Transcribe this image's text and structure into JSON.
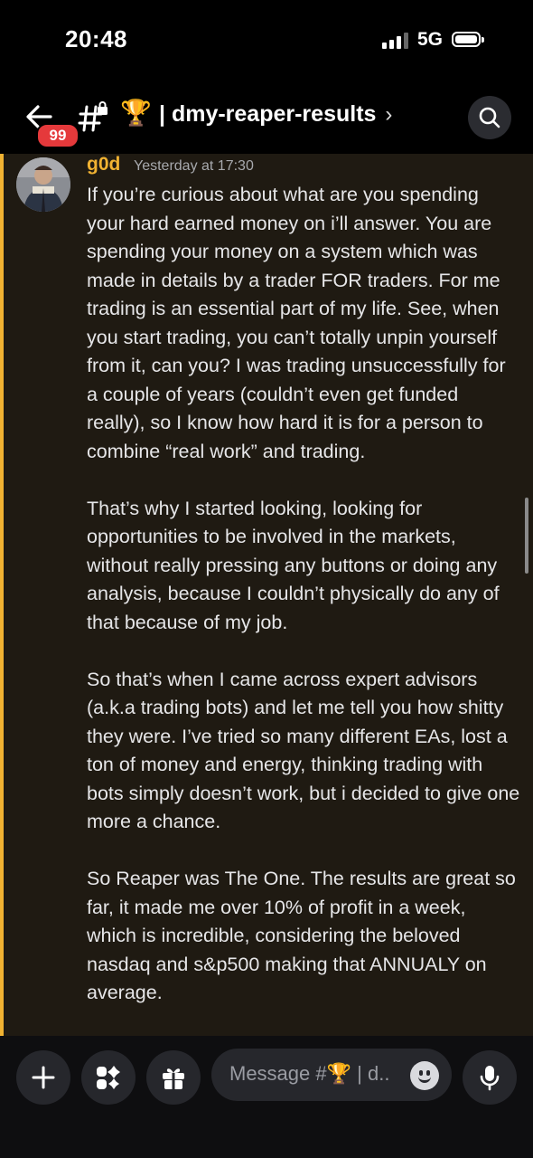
{
  "status_bar": {
    "time": "20:48",
    "network": "5G",
    "signal_bars": 3,
    "signal_max": 4,
    "battery_icon": "battery-icon"
  },
  "header": {
    "back_icon": "back-arrow-icon",
    "unread_badge": "99",
    "channel_icons": "hash-lock-icon",
    "channel_emoji": "🏆",
    "channel_name": "| dmy-reaper-results",
    "chevron": "›",
    "search_icon": "search-icon"
  },
  "message": {
    "author": "g0d",
    "author_color": "#f0b232",
    "timestamp": "Yesterday at 17:30",
    "paragraphs": [
      "If you’re curious about what are you spending your hard earned money on i’ll answer. You are spending your money on a system which was made in details by a trader FOR traders. For me trading is an essential part of my life. See, when you start trading, you can’t totally unpin yourself from it, can you? I was trading unsuccessfully for a couple of years (couldn’t even get funded really), so I know how hard it is for a person to combine “real work” and trading.",
      "That’s why I started looking, looking for opportunities to be involved in the markets, without really pressing any buttons or doing any analysis, because I couldn’t physically do any of that because of my job.",
      "So that’s when I came across expert advisors (a.k.a trading bots) and let me tell you how shitty they were. I’ve tried so many different EAs, lost a ton of money and energy, thinking trading with bots simply doesn’t work, but i decided to give one more a chance.",
      "So Reaper was The One. The results are great so far, it made me over 10% of profit in a week, which is incredible, considering the beloved nasdaq and s&p500 making that ANNUALY on average."
    ]
  },
  "composer": {
    "placeholder_prefix": "Message #",
    "placeholder_emoji": "🏆",
    "placeholder_suffix": " | d..",
    "icons": [
      "plus-icon",
      "apps-icon",
      "gift-icon",
      "emoji-icon",
      "microphone-icon"
    ]
  },
  "colors": {
    "highlight_bg": "#1f1a12",
    "highlight_bar": "#f0b232",
    "badge": "#e5393b"
  }
}
